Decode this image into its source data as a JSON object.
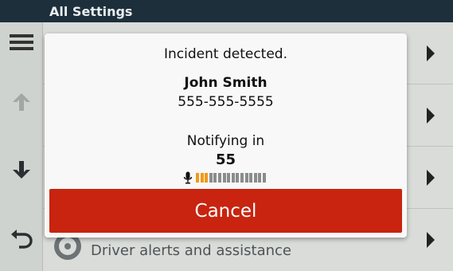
{
  "header": {
    "title": "All Settings"
  },
  "list": {
    "visible_item_label": "Driver alerts and assistance"
  },
  "dialog": {
    "title": "Incident detected.",
    "contact_name": "John Smith",
    "contact_phone": "555-555-5555",
    "notify_label": "Notifying in",
    "countdown": "55",
    "mic_level": {
      "active_segments": 3,
      "total_segments": 16
    },
    "cancel_label": "Cancel"
  },
  "icons": {
    "menu": "menu-icon",
    "up": "arrow-up-icon",
    "down": "arrow-down-icon",
    "back": "back-icon",
    "chevron": "chevron-right-icon",
    "mic": "microphone-icon",
    "wheel": "steering-wheel-icon"
  },
  "colors": {
    "header_bg": "#1d2f3a",
    "cancel_bg": "#c8240f",
    "level_active": "#f09a1c",
    "level_inactive": "#8a8d8d"
  }
}
